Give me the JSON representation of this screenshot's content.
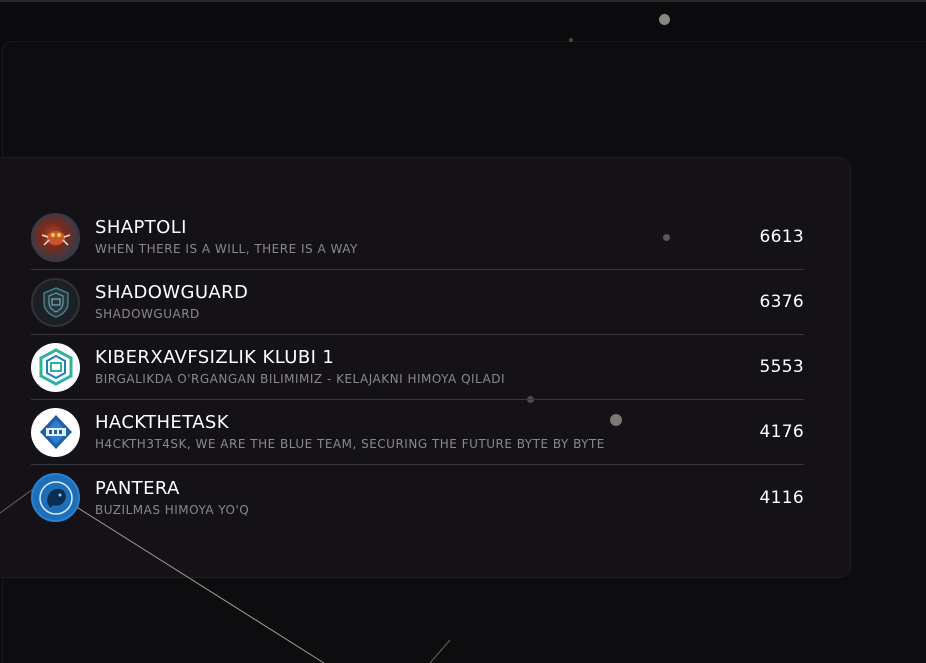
{
  "leaderboard": {
    "rows": [
      {
        "name": "SHAPTOLI",
        "motto": "WHEN THERE IS A WILL, THERE IS A WAY",
        "score": "6613",
        "avatar_icon": "spider-monster-avatar"
      },
      {
        "name": "SHADOWGUARD",
        "motto": "SHADOWGUARD",
        "score": "6376",
        "avatar_icon": "shield-avatar"
      },
      {
        "name": "KIBERXAVFSIZLIK KLUBI 1",
        "motto": "BIRGALIKDA O'RGANGAN BILIMIMIZ - KELAJAKNI HIMOYA QILADI",
        "score": "5553",
        "avatar_icon": "cube-logo-avatar"
      },
      {
        "name": "HACKTHETASK",
        "motto": "H4CKTH3T4SK, WE ARE THE BLUE TEAM, SECURING THE FUTURE BYTE BY BYTE",
        "score": "4176",
        "avatar_icon": "hack-badge-avatar"
      },
      {
        "name": "PANTERA",
        "motto": "BUZILMAS HIMOYA YO'Q",
        "score": "4116",
        "avatar_icon": "panther-avatar"
      }
    ]
  },
  "colors": {
    "background": "#0b0a0c",
    "panel": "#141217",
    "divider": "#3a383e",
    "muted_text": "#8a8790"
  }
}
